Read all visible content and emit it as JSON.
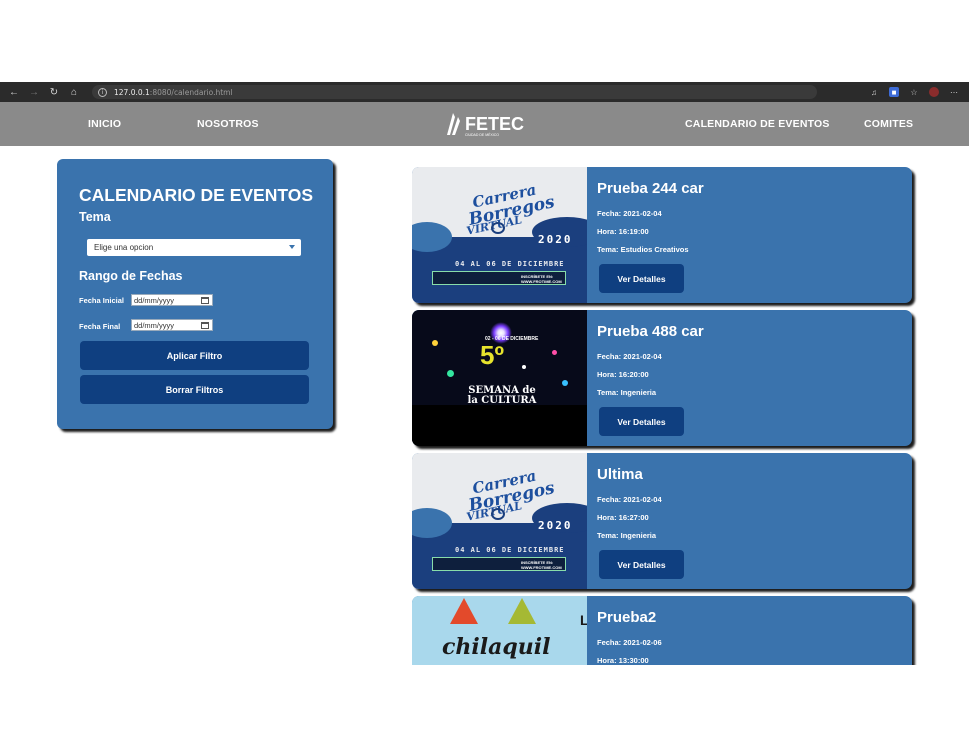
{
  "browser": {
    "url_host": "127.0.0.1",
    "url_path": ":8080/calendario.html"
  },
  "nav": {
    "inicio": "INICIO",
    "nosotros": "NOSOTROS",
    "logo_text": "FETEC",
    "logo_sub": "CIUDAD DE MÉXICO",
    "calendario": "CALENDARIO DE EVENTOS",
    "comites": "COMITES"
  },
  "filters": {
    "title": "CALENDARIO DE EVENTOS",
    "tema_label": "Tema",
    "tema_selected": "Elige una opcion",
    "rango_label": "Rango de Fechas",
    "fecha_inicial_label": "Fecha Inicial",
    "fecha_final_label": "Fecha Final",
    "date_placeholder": "dd/mm/yyyy",
    "apply_label": "Aplicar Filtro",
    "clear_label": "Borrar Filtros"
  },
  "events": [
    {
      "title": "Prueba 244 car",
      "fecha": "Fecha: 2021-02-04",
      "hora": "Hora: 16:19:00",
      "tema": "Tema: Estudios Creativos",
      "button": "Ver Detalles"
    },
    {
      "title": "Prueba 488 car",
      "fecha": "Fecha: 2021-02-04",
      "hora": "Hora: 16:20:00",
      "tema": "Tema: Ingenieria",
      "button": "Ver Detalles"
    },
    {
      "title": "Ultima",
      "fecha": "Fecha: 2021-02-04",
      "hora": "Hora: 16:27:00",
      "tema": "Tema: Ingenieria",
      "button": "Ver Detalles"
    },
    {
      "title": "Prueba2",
      "fecha": "Fecha: 2021-02-06",
      "hora": "Hora: 13:30:00"
    }
  ],
  "posters": {
    "carrera_line1": "Carrera",
    "carrera_line2": "Borregos",
    "carrera_line3": "VIRTUAL",
    "carrera_year": "2020",
    "carrera_date": "04 AL 06 DE DICIEMBRE",
    "carrera_register": "INSCRÍBETE EN: WWW.FROTIME.COM",
    "semana_number": "5º",
    "semana_date": "02 - 06 DE DICIEMBRE",
    "semana_text": "SEMANA de la CULTURA",
    "chila_text": "chilaquil",
    "chila_edge": "L"
  },
  "colors": {
    "nav_bg": "#8a8a8a",
    "panel_bg": "#3a73ad",
    "button_bg": "#0f3f80"
  }
}
